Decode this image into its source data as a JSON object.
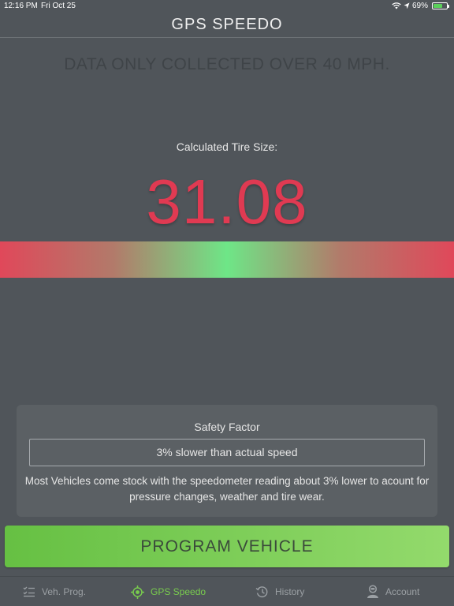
{
  "status_bar": {
    "time": "12:16 PM",
    "date": "Fri Oct 25",
    "battery_percent": "69%",
    "battery_level": 0.69
  },
  "header": {
    "title": "GPS SPEEDO"
  },
  "notice": "DATA ONLY COLLECTED OVER 40 MPH.",
  "tire": {
    "label": "Calculated Tire Size:",
    "value": "31.08"
  },
  "safety": {
    "title": "Safety Factor",
    "value": "3% slower than actual speed",
    "note": "Most Vehicles come stock with the speedometer reading about 3% lower to acount for pressure changes, weather and tire wear."
  },
  "program_button": "PROGRAM VEHICLE",
  "tabs": [
    {
      "label": "Veh. Prog.",
      "icon": "checklist-icon",
      "active": false
    },
    {
      "label": "GPS Speedo",
      "icon": "crosshair-icon",
      "active": true
    },
    {
      "label": "History",
      "icon": "history-icon",
      "active": false
    },
    {
      "label": "Account",
      "icon": "account-icon",
      "active": false
    }
  ],
  "colors": {
    "background": "#50555a",
    "tire_value": "#e03a52",
    "accent_green": "#79cc4e"
  }
}
